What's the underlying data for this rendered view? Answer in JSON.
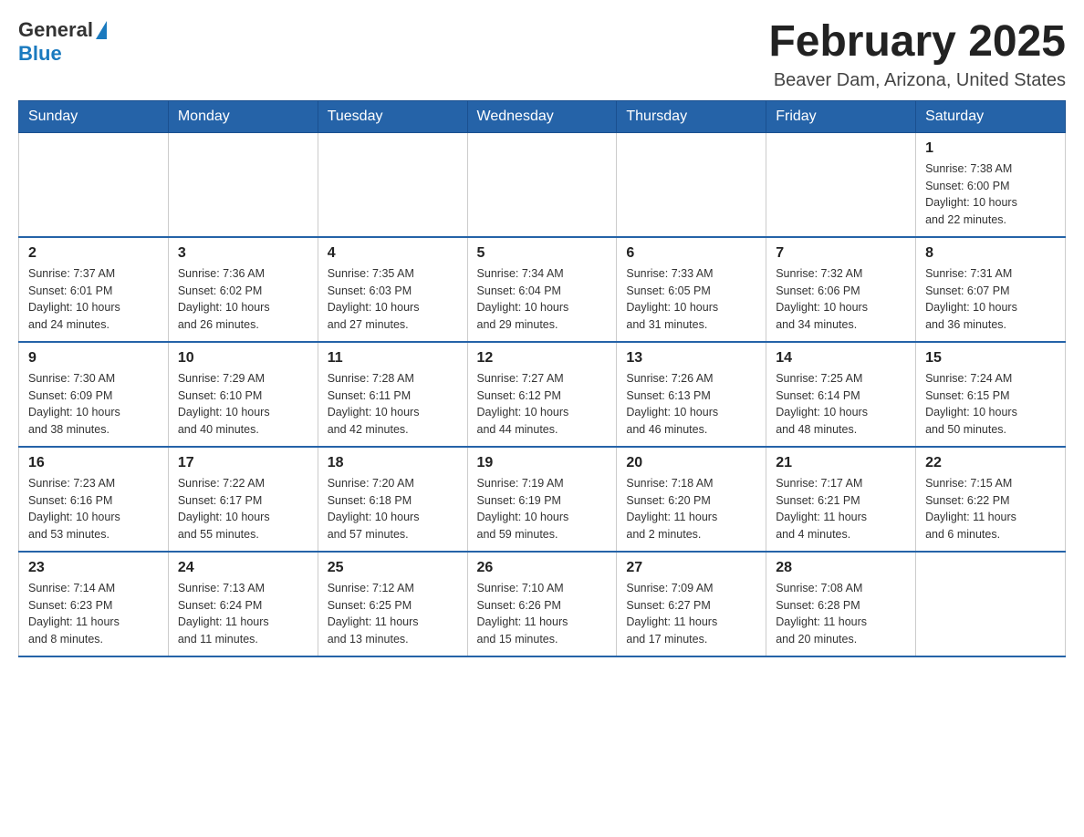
{
  "header": {
    "logo_general": "General",
    "logo_blue": "Blue",
    "month_title": "February 2025",
    "location": "Beaver Dam, Arizona, United States"
  },
  "weekdays": [
    "Sunday",
    "Monday",
    "Tuesday",
    "Wednesday",
    "Thursday",
    "Friday",
    "Saturday"
  ],
  "weeks": [
    [
      {
        "day": "",
        "info": ""
      },
      {
        "day": "",
        "info": ""
      },
      {
        "day": "",
        "info": ""
      },
      {
        "day": "",
        "info": ""
      },
      {
        "day": "",
        "info": ""
      },
      {
        "day": "",
        "info": ""
      },
      {
        "day": "1",
        "info": "Sunrise: 7:38 AM\nSunset: 6:00 PM\nDaylight: 10 hours\nand 22 minutes."
      }
    ],
    [
      {
        "day": "2",
        "info": "Sunrise: 7:37 AM\nSunset: 6:01 PM\nDaylight: 10 hours\nand 24 minutes."
      },
      {
        "day": "3",
        "info": "Sunrise: 7:36 AM\nSunset: 6:02 PM\nDaylight: 10 hours\nand 26 minutes."
      },
      {
        "day": "4",
        "info": "Sunrise: 7:35 AM\nSunset: 6:03 PM\nDaylight: 10 hours\nand 27 minutes."
      },
      {
        "day": "5",
        "info": "Sunrise: 7:34 AM\nSunset: 6:04 PM\nDaylight: 10 hours\nand 29 minutes."
      },
      {
        "day": "6",
        "info": "Sunrise: 7:33 AM\nSunset: 6:05 PM\nDaylight: 10 hours\nand 31 minutes."
      },
      {
        "day": "7",
        "info": "Sunrise: 7:32 AM\nSunset: 6:06 PM\nDaylight: 10 hours\nand 34 minutes."
      },
      {
        "day": "8",
        "info": "Sunrise: 7:31 AM\nSunset: 6:07 PM\nDaylight: 10 hours\nand 36 minutes."
      }
    ],
    [
      {
        "day": "9",
        "info": "Sunrise: 7:30 AM\nSunset: 6:09 PM\nDaylight: 10 hours\nand 38 minutes."
      },
      {
        "day": "10",
        "info": "Sunrise: 7:29 AM\nSunset: 6:10 PM\nDaylight: 10 hours\nand 40 minutes."
      },
      {
        "day": "11",
        "info": "Sunrise: 7:28 AM\nSunset: 6:11 PM\nDaylight: 10 hours\nand 42 minutes."
      },
      {
        "day": "12",
        "info": "Sunrise: 7:27 AM\nSunset: 6:12 PM\nDaylight: 10 hours\nand 44 minutes."
      },
      {
        "day": "13",
        "info": "Sunrise: 7:26 AM\nSunset: 6:13 PM\nDaylight: 10 hours\nand 46 minutes."
      },
      {
        "day": "14",
        "info": "Sunrise: 7:25 AM\nSunset: 6:14 PM\nDaylight: 10 hours\nand 48 minutes."
      },
      {
        "day": "15",
        "info": "Sunrise: 7:24 AM\nSunset: 6:15 PM\nDaylight: 10 hours\nand 50 minutes."
      }
    ],
    [
      {
        "day": "16",
        "info": "Sunrise: 7:23 AM\nSunset: 6:16 PM\nDaylight: 10 hours\nand 53 minutes."
      },
      {
        "day": "17",
        "info": "Sunrise: 7:22 AM\nSunset: 6:17 PM\nDaylight: 10 hours\nand 55 minutes."
      },
      {
        "day": "18",
        "info": "Sunrise: 7:20 AM\nSunset: 6:18 PM\nDaylight: 10 hours\nand 57 minutes."
      },
      {
        "day": "19",
        "info": "Sunrise: 7:19 AM\nSunset: 6:19 PM\nDaylight: 10 hours\nand 59 minutes."
      },
      {
        "day": "20",
        "info": "Sunrise: 7:18 AM\nSunset: 6:20 PM\nDaylight: 11 hours\nand 2 minutes."
      },
      {
        "day": "21",
        "info": "Sunrise: 7:17 AM\nSunset: 6:21 PM\nDaylight: 11 hours\nand 4 minutes."
      },
      {
        "day": "22",
        "info": "Sunrise: 7:15 AM\nSunset: 6:22 PM\nDaylight: 11 hours\nand 6 minutes."
      }
    ],
    [
      {
        "day": "23",
        "info": "Sunrise: 7:14 AM\nSunset: 6:23 PM\nDaylight: 11 hours\nand 8 minutes."
      },
      {
        "day": "24",
        "info": "Sunrise: 7:13 AM\nSunset: 6:24 PM\nDaylight: 11 hours\nand 11 minutes."
      },
      {
        "day": "25",
        "info": "Sunrise: 7:12 AM\nSunset: 6:25 PM\nDaylight: 11 hours\nand 13 minutes."
      },
      {
        "day": "26",
        "info": "Sunrise: 7:10 AM\nSunset: 6:26 PM\nDaylight: 11 hours\nand 15 minutes."
      },
      {
        "day": "27",
        "info": "Sunrise: 7:09 AM\nSunset: 6:27 PM\nDaylight: 11 hours\nand 17 minutes."
      },
      {
        "day": "28",
        "info": "Sunrise: 7:08 AM\nSunset: 6:28 PM\nDaylight: 11 hours\nand 20 minutes."
      },
      {
        "day": "",
        "info": ""
      }
    ]
  ]
}
